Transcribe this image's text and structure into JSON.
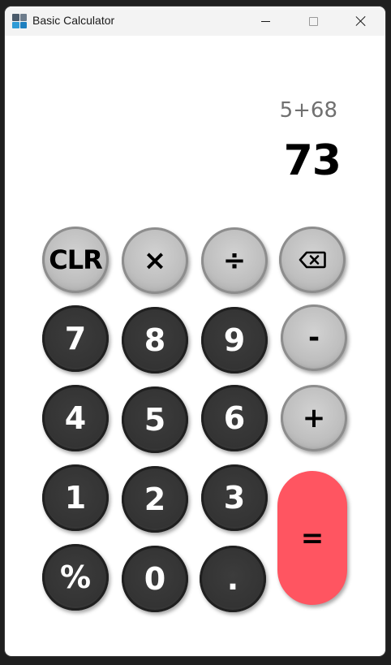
{
  "window": {
    "title": "Basic Calculator",
    "icon": "calculator-app-icon"
  },
  "display": {
    "expression": "5+68",
    "result": "73"
  },
  "keys": {
    "clear": "CLR",
    "multiply": "×",
    "divide": "÷",
    "backspace_icon": "backspace-icon",
    "seven": "7",
    "eight": "8",
    "nine": "9",
    "minus": "-",
    "four": "4",
    "five": "5",
    "six": "6",
    "plus": "+",
    "one": "1",
    "two": "2",
    "three": "3",
    "percent": "%",
    "zero": "0",
    "decimal": ".",
    "equals": "="
  },
  "colors": {
    "equals_button": "#ff5561",
    "dark_button": "#353535",
    "light_button": "#c0c0c0",
    "expression_text": "#707070",
    "result_text": "#000000"
  }
}
